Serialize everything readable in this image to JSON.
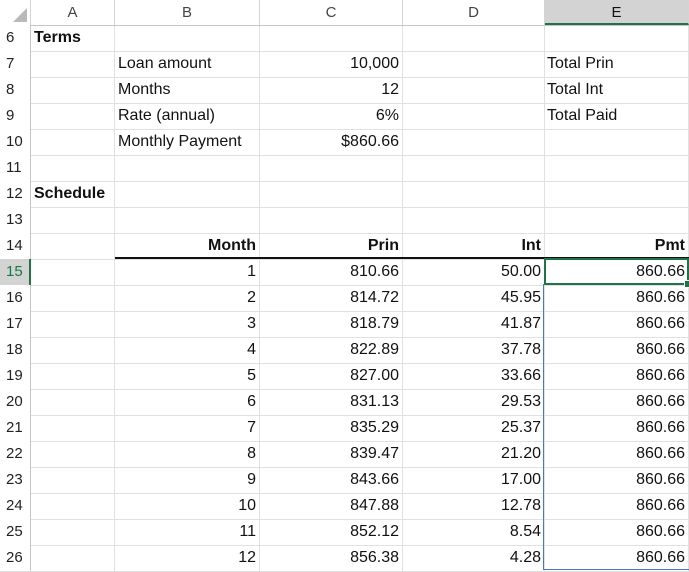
{
  "columns": [
    "A",
    "B",
    "C",
    "D",
    "E"
  ],
  "selected_column": "E",
  "rows": [
    "6",
    "7",
    "8",
    "9",
    "10",
    "11",
    "12",
    "13",
    "14",
    "15",
    "16",
    "17",
    "18",
    "19",
    "20",
    "21",
    "22",
    "23",
    "24",
    "25",
    "26"
  ],
  "selected_row": "15",
  "terms": {
    "title": "Terms",
    "loan_amount_label": "Loan amount",
    "loan_amount_value": "10,000",
    "months_label": "Months",
    "months_value": "12",
    "rate_label": "Rate (annual)",
    "rate_value": "6%",
    "payment_label": "Monthly Payment",
    "payment_value": "$860.66",
    "total_prin_label": "Total Prin",
    "total_int_label": "Total Int",
    "total_paid_label": "Total Paid"
  },
  "schedule": {
    "title": "Schedule",
    "headers": [
      "Month",
      "Prin",
      "Int",
      "Pmt"
    ],
    "rows": [
      [
        "1",
        "810.66",
        "50.00",
        "860.66"
      ],
      [
        "2",
        "814.72",
        "45.95",
        "860.66"
      ],
      [
        "3",
        "818.79",
        "41.87",
        "860.66"
      ],
      [
        "4",
        "822.89",
        "37.78",
        "860.66"
      ],
      [
        "5",
        "827.00",
        "33.66",
        "860.66"
      ],
      [
        "6",
        "831.13",
        "29.53",
        "860.66"
      ],
      [
        "7",
        "835.29",
        "25.37",
        "860.66"
      ],
      [
        "8",
        "839.47",
        "21.20",
        "860.66"
      ],
      [
        "9",
        "843.66",
        "17.00",
        "860.66"
      ],
      [
        "10",
        "847.88",
        "12.78",
        "860.66"
      ],
      [
        "11",
        "852.12",
        "8.54",
        "860.66"
      ],
      [
        "12",
        "856.38",
        "4.28",
        "860.66"
      ]
    ]
  },
  "colors": {
    "accent": "#217346",
    "header_selected_bg": "#d3d3d3",
    "gridline": "#e1e1e1",
    "range_border": "#4a7ab8"
  }
}
